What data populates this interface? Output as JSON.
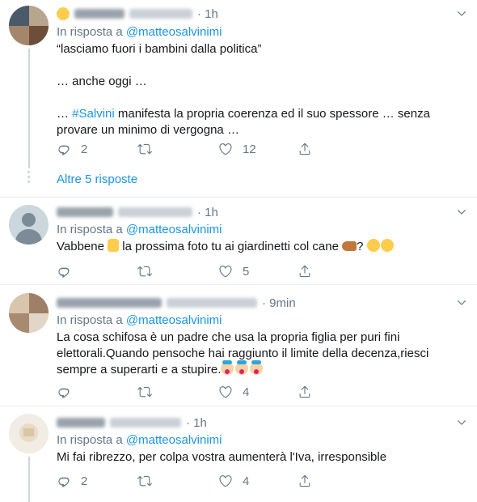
{
  "icons": {
    "reply": "reply-icon",
    "retweet": "retweet-icon",
    "like": "heart-icon",
    "share": "share-icon",
    "more": "chevron-down-icon"
  },
  "colors": {
    "accent": "#1b95e0",
    "muted": "#657786",
    "text": "#14171a",
    "divider": "#e6ecf0"
  },
  "tweets": [
    {
      "time": "1h",
      "reply_prefix": "In risposta a ",
      "reply_handle": "@matteosalvinimi",
      "lines": {
        "l1": "“lasciamo fuori i bambini dalla politica”",
        "l2": "… anche oggi …",
        "l3_hashtag": "#Salvini",
        "l3_rest": " manifesta la propria coerenza ed il suo spessore … senza",
        "l4": "provare un minimo di vergogna …"
      },
      "replies": "2",
      "retweets": "",
      "likes": "12"
    },
    {
      "time": "1h",
      "reply_prefix": "In risposta a ",
      "reply_handle": "@matteosalvinimi",
      "lines": {
        "l1a": "Vabbene ",
        "l1b": " la prossima foto tu ai giardinetti col cane ",
        "l1c": "?"
      },
      "replies": "",
      "retweets": "",
      "likes": "5"
    },
    {
      "time": "9min",
      "reply_prefix": "In risposta a ",
      "reply_handle": "@matteosalvinimi",
      "lines": {
        "l1": "La cosa schifosa è un padre che usa la propria figlia per puri fini",
        "l2": "elettorali.Quando pensoche hai raggiunto il limite della decenza,riesci",
        "l3": "sempre a superarti e a stupire."
      },
      "replies": "",
      "retweets": "",
      "likes": "4"
    },
    {
      "time": "1h",
      "reply_prefix": "In risposta a ",
      "reply_handle": "@matteosalvinimi",
      "lines": {
        "l1": "Mi fai ribrezzo, per colpa vostra aumenterà l'Iva, irresponsible"
      },
      "replies": "2",
      "retweets": "",
      "likes": "4"
    }
  ],
  "more_replies": "Altre 5 risposte"
}
